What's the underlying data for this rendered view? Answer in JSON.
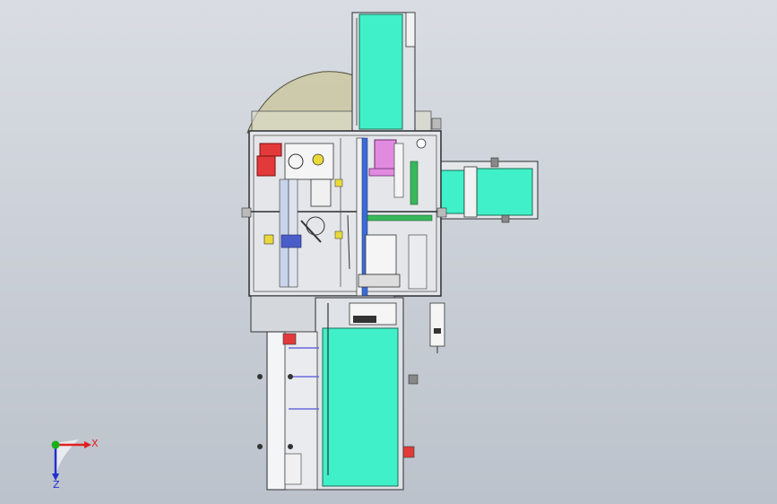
{
  "viewport": {
    "background_top": "#d9dde3",
    "background_bottom": "#bcc2cb"
  },
  "colors": {
    "conveyor_belt": "#3ff0c8",
    "frame_steel": "#e4e6ea",
    "outline": "#2a2d33",
    "dome_glass": "#c9c69a",
    "motor_red": "#e23a3a",
    "magenta_block": "#e08be0",
    "green_rail": "#38b85a",
    "axis_x": "#e02020",
    "axis_y": "#18b018",
    "axis_z": "#2030d0"
  },
  "triad": {
    "x_label": "X",
    "z_label": "Z"
  }
}
